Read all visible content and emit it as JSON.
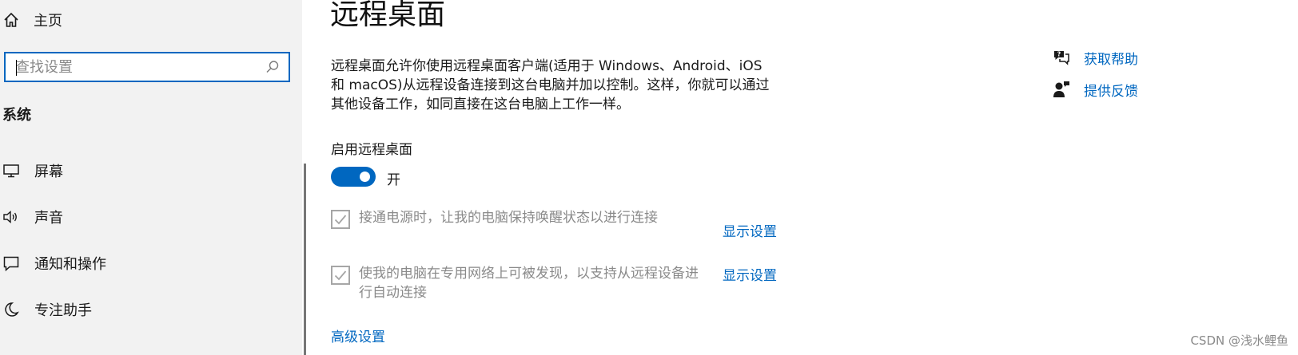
{
  "sidebar": {
    "home_label": "主页",
    "search_placeholder": "查找设置",
    "section_title": "系统",
    "items": [
      {
        "label": "屏幕",
        "icon": "monitor-icon"
      },
      {
        "label": "声音",
        "icon": "speaker-icon"
      },
      {
        "label": "通知和操作",
        "icon": "message-icon"
      },
      {
        "label": "专注助手",
        "icon": "moon-icon"
      }
    ]
  },
  "main": {
    "title": "远程桌面",
    "description": "远程桌面允许你使用远程桌面客户端(适用于 Windows、Android、iOS 和 macOS)从远程设备连接到这台电脑并加以控制。这样，你就可以通过其他设备工作，如同直接在这台电脑上工作一样。",
    "enable_label": "启用远程桌面",
    "toggle_on": true,
    "toggle_state": "开",
    "options": [
      {
        "text": "接通电源时，让我的电脑保持唤醒状态以进行连接",
        "checked": true,
        "link": "显示设置"
      },
      {
        "text": "使我的电脑在专用网络上可被发现，以支持从远程设备进行自动连接",
        "checked": true,
        "link": "显示设置"
      }
    ],
    "advanced_link": "高级设置"
  },
  "help": {
    "get_help": "获取帮助",
    "feedback": "提供反馈"
  },
  "watermark": "CSDN @浅水鲤鱼",
  "colors": {
    "accent": "#0067c0",
    "sidebar_bg": "#f2f2f2",
    "disabled_text": "#8a8a8a"
  }
}
